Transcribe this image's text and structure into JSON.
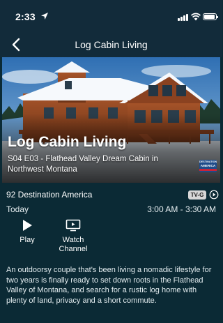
{
  "status_bar": {
    "time": "2:33",
    "icons": [
      "location-arrow-icon",
      "cellular-signal-icon",
      "wifi-icon",
      "battery-icon"
    ]
  },
  "nav": {
    "title": "Log Cabin Living",
    "back_icon": "chevron-left-icon"
  },
  "hero": {
    "show_title": "Log Cabin Living",
    "episode_line": "S04 E03 - Flathead Valley Dream Cabin in Northwest Montana",
    "network_logo": {
      "top_text": "DESTINATION",
      "main_text": "AMERICA"
    }
  },
  "details": {
    "channel": "92 Destination America",
    "rating": "TV-G",
    "date": "Today",
    "time_range": "3:00 AM - 3:30 AM",
    "info_icon": "replay-info-icon"
  },
  "actions": [
    {
      "label": "Play",
      "icon": "play-icon"
    },
    {
      "label": "Watch Channel",
      "icon": "tv-icon"
    }
  ],
  "description": "An outdoorsy couple that's been living a nomadic lifestyle for two years is finally ready to set down roots in the Flathead Valley of Montana, and search for a rustic log home with plenty of land, privacy and a short commute.",
  "colors": {
    "background": "#0b2a35",
    "header": "#122b3a",
    "rating_badge": "#d7d7d7",
    "network_blue": "#1e4b8a",
    "network_red": "#c8243a"
  }
}
